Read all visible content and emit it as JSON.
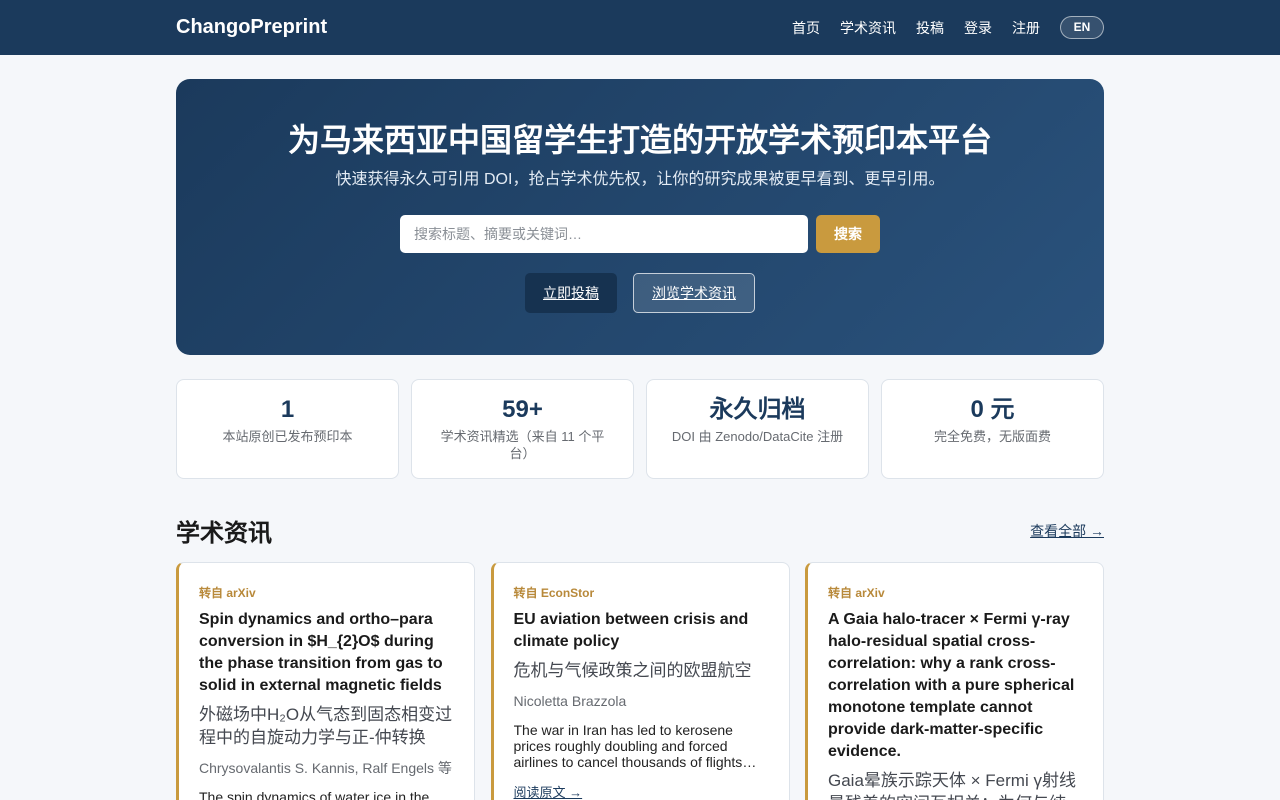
{
  "header": {
    "brand": "ChangoPreprint",
    "nav": [
      "首页",
      "学术资讯",
      "投稿",
      "登录",
      "注册"
    ],
    "lang": "EN"
  },
  "hero": {
    "title": "为马来西亚中国留学生打造的开放学术预印本平台",
    "subtitle": "快速获得永久可引用 DOI，抢占学术优先权，让你的研究成果被更早看到、更早引用。",
    "search_placeholder": "搜索标题、摘要或关键词…",
    "search_button": "搜索",
    "cta_primary": "立即投稿",
    "cta_secondary": "浏览学术资讯"
  },
  "stats": [
    {
      "value": "1",
      "label": "本站原创已发布预印本"
    },
    {
      "value": "59+",
      "label": "学术资讯精选（来自 11 个平台）"
    },
    {
      "value": "永久归档",
      "label": "DOI 由 Zenodo/DataCite 注册"
    },
    {
      "value": "0 元",
      "label": "完全免费，无版面费"
    }
  ],
  "news": {
    "title": "学术资讯",
    "view_all": "查看全部 →",
    "items": [
      {
        "source": "转自 arXiv",
        "title": "Spin dynamics and ortho–para conversion in $H_{2}O$ during the phase transition from gas to solid in external magnetic fields",
        "title_zh": "外磁场中H₂O从气态到固态相变过程中的自旋动力学与正-仲转换",
        "authors": "Chrysovalantis S. Kannis, Ralf Engels 等",
        "abstract": "The spin dynamics of water ice in the",
        "link": ""
      },
      {
        "source": "转自 EconStor",
        "title": "EU aviation between crisis and climate policy",
        "title_zh": "危机与气候政策之间的欧盟航空",
        "authors": "Nicoletta Brazzola",
        "abstract": "The war in Iran has led to kerosene prices roughly doubling and forced airlines to cancel thousands of flights and reduce capacity",
        "link": "阅读原文 →"
      },
      {
        "source": "转自 arXiv",
        "title": "A Gaia halo-tracer × Fermi γ-ray halo-residual spatial cross-correlation: why a rank cross-correlation with a pure spherical monotone template cannot provide dark-matter-specific evidence.",
        "title_zh": "Gaia晕族示踪天体 × Fermi γ射线晕残差的空间互相关：为何与纯",
        "authors": "",
        "abstract": "",
        "link": ""
      }
    ]
  }
}
